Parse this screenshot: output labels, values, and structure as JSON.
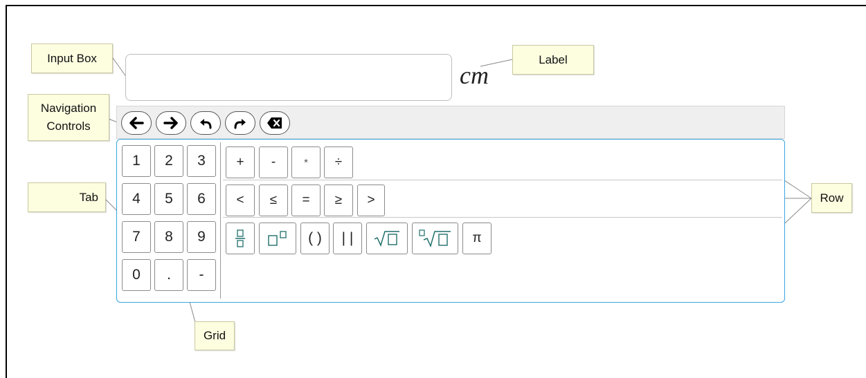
{
  "callouts": {
    "input_box": "Input Box",
    "label": "Label",
    "navigation": "Navigation Controls",
    "tab": "Tab",
    "row": "Row",
    "grid": "Grid"
  },
  "unit_label": "cm",
  "navigation_controls": [
    {
      "name": "left-arrow-icon"
    },
    {
      "name": "right-arrow-icon"
    },
    {
      "name": "undo-icon"
    },
    {
      "name": "redo-icon"
    },
    {
      "name": "backspace-icon"
    }
  ],
  "number_keys": [
    "1",
    "2",
    "3",
    "4",
    "5",
    "6",
    "7",
    "8",
    "9",
    "0",
    ".",
    "-"
  ],
  "operator_row": [
    "+",
    "-",
    "*",
    "÷"
  ],
  "comparison_row": [
    "<",
    "≤",
    "=",
    "≥",
    ">"
  ],
  "function_row": [
    "fraction",
    "exponent",
    "( )",
    "| |",
    "√□",
    "ⁿ√□",
    "π"
  ],
  "colors": {
    "keypad_border": "#3aa5e0",
    "callout_bg": "#fdfde0",
    "nav_bg": "#efefef"
  }
}
